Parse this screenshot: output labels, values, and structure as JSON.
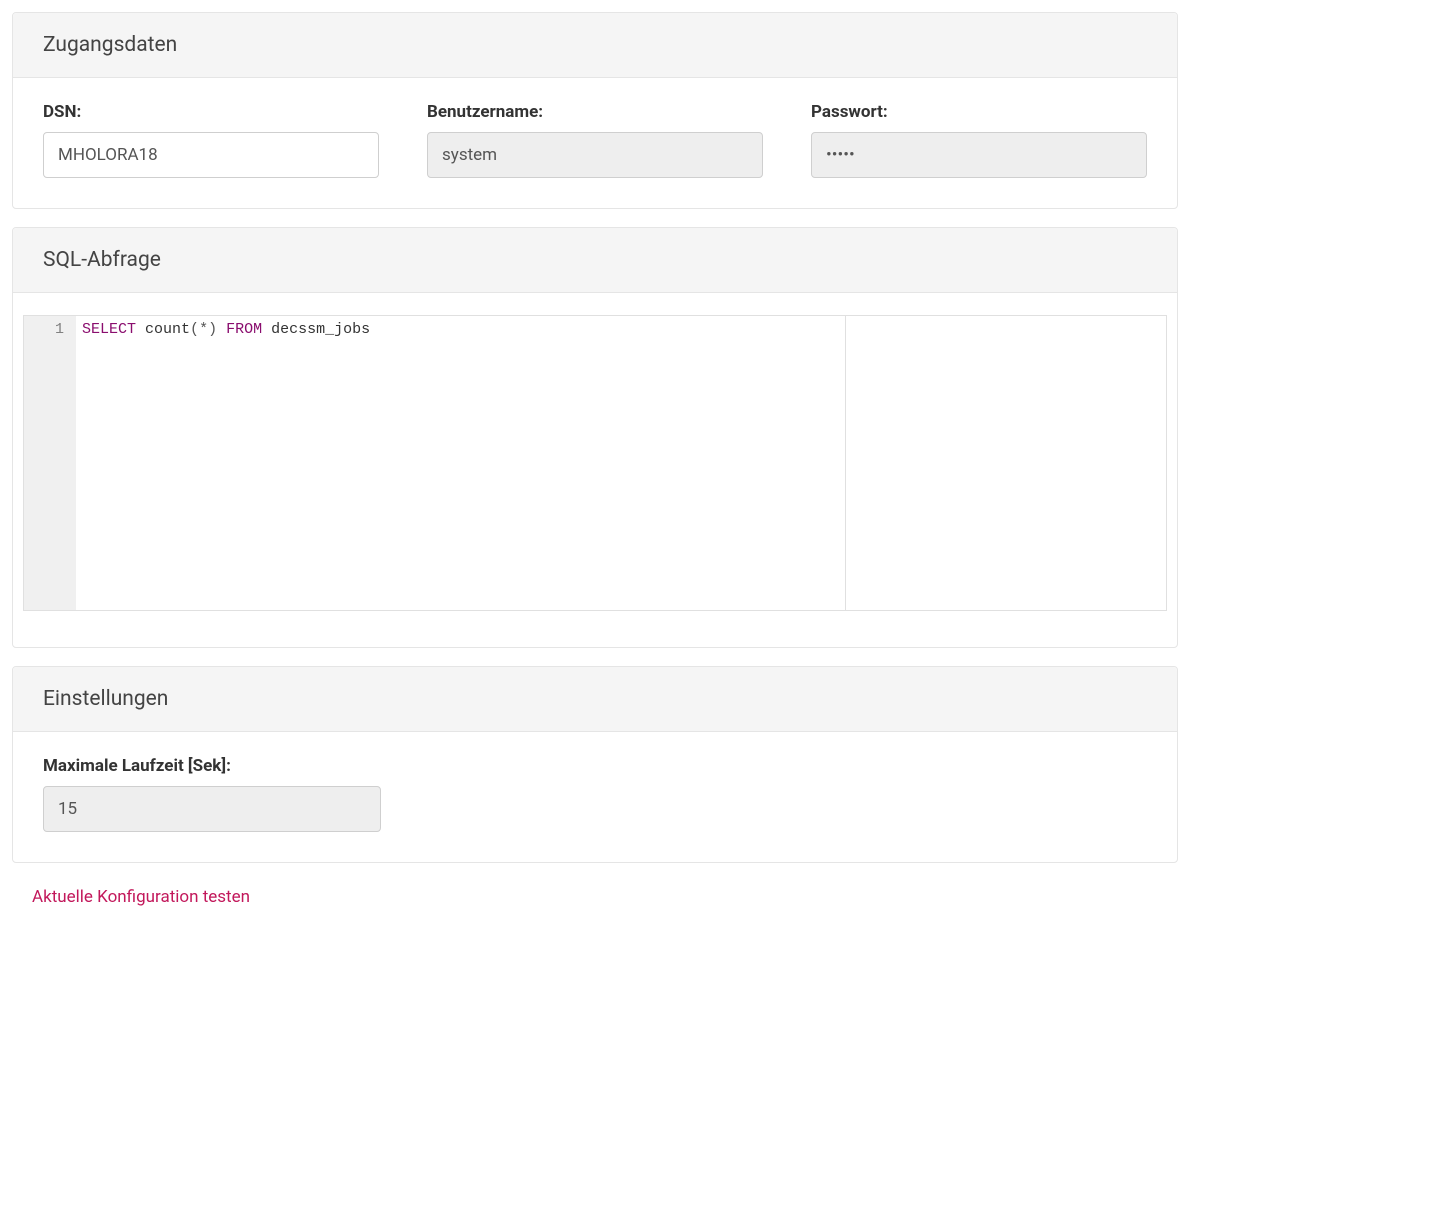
{
  "credentials": {
    "title": "Zugangsdaten",
    "dsn_label": "DSN:",
    "dsn_value": "MHOLORA18",
    "user_label": "Benutzername:",
    "user_value": "system",
    "pass_label": "Passwort:",
    "pass_value": "•••••"
  },
  "sql": {
    "title": "SQL-Abfrage",
    "line_number": "1",
    "tokens": {
      "select": "SELECT",
      "count": "count",
      "lparen": "(",
      "star": "*",
      "rparen": ")",
      "from": "FROM",
      "table": "decssm_jobs"
    }
  },
  "settings": {
    "title": "Einstellungen",
    "maxtime_label": "Maximale Laufzeit [Sek]:",
    "maxtime_value": "15"
  },
  "actions": {
    "test_config": "Aktuelle Konfiguration testen"
  }
}
